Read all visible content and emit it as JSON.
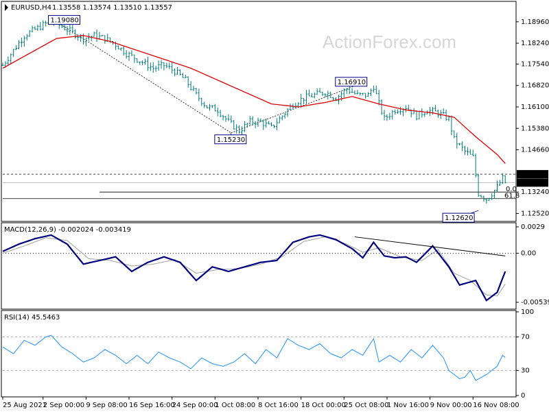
{
  "header": {
    "symbol": "EURUSD,H4",
    "ohlc": "1.13558 1.13574 1.13510 1.13557"
  },
  "watermark": "ActionForex.com",
  "colors": {
    "candle": "#007b7b",
    "ma": "#e00000",
    "macd": "#000080",
    "signal": "#a0a0a0",
    "rsi": "#1e90ff",
    "grid": "#000000",
    "label_border": "#000080"
  },
  "chart_data": [
    {
      "type": "candlestick",
      "name": "price",
      "ylim": [
        1.123,
        1.196
      ],
      "y_ticks": [
        "1.18960",
        "1.18240",
        "1.17540",
        "1.16820",
        "1.16100",
        "1.15380",
        "1.14660",
        "1.13240",
        "1.12520"
      ],
      "y_tick_values": [
        1.1896,
        1.1824,
        1.1754,
        1.1682,
        1.161,
        1.1538,
        1.1466,
        1.1324,
        1.1252
      ],
      "current_price_label": "1.13557",
      "current_price": 1.13557,
      "hline_label": "1.13840",
      "hline_value": 1.1384,
      "fib_labels": [
        "0.0",
        "61.8"
      ],
      "fib_values": [
        1.1324,
        1.1302
      ],
      "annotations": [
        {
          "text": "1.19080",
          "x": 18,
          "y": 1.1908
        },
        {
          "text": "1.15230",
          "x": 85,
          "y": 1.1523
        },
        {
          "text": "1.16910",
          "x": 134,
          "y": 1.1691
        },
        {
          "text": "1.12620",
          "x": 177,
          "y": 1.1262
        }
      ],
      "x_labels": [
        "25 Aug 2021",
        "2 Sep 00:00",
        "9 Sep 08:00",
        "16 Sep 16:00",
        "24 Sep 00:00",
        "1 Oct 08:00",
        "8 Oct 16:00",
        "18 Oct 00:00",
        "25 Oct 08:00",
        "1 Nov 16:00",
        "9 Nov 00:00",
        "16 Nov 08:00"
      ],
      "x_label_bars": [
        0,
        15,
        31,
        47,
        63,
        79,
        95,
        111,
        127,
        143,
        159,
        175
      ],
      "price_points": [
        [
          0,
          1.175
        ],
        [
          4,
          1.18
        ],
        [
          8,
          1.185
        ],
        [
          12,
          1.187
        ],
        [
          18,
          1.19
        ],
        [
          22,
          1.188
        ],
        [
          26,
          1.186
        ],
        [
          30,
          1.184
        ],
        [
          34,
          1.185
        ],
        [
          38,
          1.184
        ],
        [
          42,
          1.182
        ],
        [
          46,
          1.179
        ],
        [
          52,
          1.176
        ],
        [
          56,
          1.174
        ],
        [
          60,
          1.175
        ],
        [
          64,
          1.173
        ],
        [
          68,
          1.17
        ],
        [
          72,
          1.165
        ],
        [
          76,
          1.161
        ],
        [
          80,
          1.16
        ],
        [
          84,
          1.156
        ],
        [
          88,
          1.153
        ],
        [
          92,
          1.156
        ],
        [
          96,
          1.156
        ],
        [
          100,
          1.154
        ],
        [
          104,
          1.158
        ],
        [
          108,
          1.162
        ],
        [
          112,
          1.164
        ],
        [
          116,
          1.165
        ],
        [
          120,
          1.166
        ],
        [
          124,
          1.164
        ],
        [
          128,
          1.167
        ],
        [
          132,
          1.165
        ],
        [
          136,
          1.165
        ],
        [
          138,
          1.168
        ],
        [
          140,
          1.162
        ],
        [
          142,
          1.157
        ],
        [
          146,
          1.16
        ],
        [
          150,
          1.161
        ],
        [
          154,
          1.158
        ],
        [
          158,
          1.16
        ],
        [
          162,
          1.159
        ],
        [
          166,
          1.157
        ],
        [
          168,
          1.15
        ],
        [
          172,
          1.146
        ],
        [
          175,
          1.144
        ],
        [
          177,
          1.132
        ],
        [
          180,
          1.13
        ],
        [
          184,
          1.134
        ],
        [
          186,
          1.137
        ],
        [
          187,
          1.13557
        ]
      ],
      "ma_points": [
        [
          0,
          1.174
        ],
        [
          10,
          1.179
        ],
        [
          20,
          1.184
        ],
        [
          30,
          1.185
        ],
        [
          40,
          1.183
        ],
        [
          50,
          1.18
        ],
        [
          60,
          1.177
        ],
        [
          70,
          1.174
        ],
        [
          80,
          1.17
        ],
        [
          90,
          1.166
        ],
        [
          100,
          1.162
        ],
        [
          110,
          1.161
        ],
        [
          120,
          1.1625
        ],
        [
          130,
          1.1645
        ],
        [
          140,
          1.162
        ],
        [
          150,
          1.16
        ],
        [
          160,
          1.159
        ],
        [
          168,
          1.1575
        ],
        [
          176,
          1.151
        ],
        [
          184,
          1.145
        ],
        [
          187,
          1.142
        ]
      ]
    },
    {
      "type": "line",
      "name": "MACD(12,26,9) -0.002024 -0.003419",
      "ylim": [
        -0.006,
        0.0032
      ],
      "y_ticks": [
        "0.0029",
        "0.00",
        "-0.005396"
      ],
      "y_tick_values": [
        0.0029,
        0.0,
        -0.005396
      ],
      "macd_points": [
        [
          0,
          0.0002
        ],
        [
          6,
          0.001
        ],
        [
          12,
          0.0016
        ],
        [
          18,
          0.002
        ],
        [
          24,
          0.001
        ],
        [
          30,
          -0.0012
        ],
        [
          36,
          -0.0008
        ],
        [
          42,
          -0.0004
        ],
        [
          48,
          -0.002
        ],
        [
          54,
          -0.001
        ],
        [
          60,
          -0.0004
        ],
        [
          66,
          -0.001
        ],
        [
          72,
          -0.003
        ],
        [
          78,
          -0.0015
        ],
        [
          84,
          -0.002
        ],
        [
          90,
          -0.0015
        ],
        [
          96,
          -0.001
        ],
        [
          102,
          -0.0008
        ],
        [
          108,
          0.0012
        ],
        [
          114,
          0.0018
        ],
        [
          118,
          0.002
        ],
        [
          124,
          0.0015
        ],
        [
          130,
          0.0005
        ],
        [
          134,
          -0.0005
        ],
        [
          138,
          0.0012
        ],
        [
          142,
          -0.0003
        ],
        [
          146,
          -0.0005
        ],
        [
          150,
          -0.0004
        ],
        [
          154,
          -0.001
        ],
        [
          160,
          0.0008
        ],
        [
          166,
          -0.0015
        ],
        [
          170,
          -0.0035
        ],
        [
          176,
          -0.003
        ],
        [
          180,
          -0.0052
        ],
        [
          184,
          -0.0043
        ],
        [
          187,
          -0.002
        ]
      ],
      "signal_points": [
        [
          0,
          0.0
        ],
        [
          8,
          0.0008
        ],
        [
          16,
          0.0017
        ],
        [
          24,
          0.0014
        ],
        [
          32,
          -0.0006
        ],
        [
          40,
          -0.0008
        ],
        [
          48,
          -0.0014
        ],
        [
          56,
          -0.0012
        ],
        [
          64,
          -0.0007
        ],
        [
          72,
          -0.0022
        ],
        [
          80,
          -0.0018
        ],
        [
          88,
          -0.0017
        ],
        [
          96,
          -0.0012
        ],
        [
          104,
          -0.0004
        ],
        [
          112,
          0.0013
        ],
        [
          120,
          0.0018
        ],
        [
          128,
          0.001
        ],
        [
          134,
          0.0001
        ],
        [
          140,
          0.0006
        ],
        [
          148,
          -0.0004
        ],
        [
          156,
          -0.0008
        ],
        [
          162,
          0.0004
        ],
        [
          168,
          -0.0022
        ],
        [
          174,
          -0.003
        ],
        [
          180,
          -0.0046
        ],
        [
          184,
          -0.0047
        ],
        [
          187,
          -0.0034
        ]
      ],
      "trendline": [
        [
          131,
          0.0018
        ],
        [
          187,
          -0.0003
        ]
      ]
    },
    {
      "type": "line",
      "name": "RSI(14) 45.5463",
      "ylim": [
        0,
        100
      ],
      "y_ticks": [
        "100",
        "70",
        "30",
        "0"
      ],
      "y_tick_values": [
        100,
        70,
        30,
        0
      ],
      "levels": [
        70,
        30
      ],
      "rsi_points": [
        [
          0,
          58
        ],
        [
          4,
          50
        ],
        [
          8,
          66
        ],
        [
          12,
          60
        ],
        [
          16,
          70
        ],
        [
          18,
          72
        ],
        [
          22,
          58
        ],
        [
          26,
          50
        ],
        [
          30,
          40
        ],
        [
          34,
          45
        ],
        [
          38,
          55
        ],
        [
          42,
          48
        ],
        [
          46,
          38
        ],
        [
          50,
          48
        ],
        [
          54,
          38
        ],
        [
          58,
          52
        ],
        [
          62,
          45
        ],
        [
          66,
          40
        ],
        [
          70,
          32
        ],
        [
          74,
          45
        ],
        [
          78,
          38
        ],
        [
          82,
          35
        ],
        [
          86,
          40
        ],
        [
          90,
          50
        ],
        [
          94,
          38
        ],
        [
          98,
          55
        ],
        [
          102,
          45
        ],
        [
          106,
          68
        ],
        [
          110,
          60
        ],
        [
          114,
          55
        ],
        [
          118,
          62
        ],
        [
          122,
          50
        ],
        [
          126,
          45
        ],
        [
          130,
          55
        ],
        [
          134,
          48
        ],
        [
          138,
          68
        ],
        [
          140,
          40
        ],
        [
          144,
          48
        ],
        [
          148,
          40
        ],
        [
          152,
          55
        ],
        [
          156,
          45
        ],
        [
          160,
          60
        ],
        [
          164,
          45
        ],
        [
          166,
          30
        ],
        [
          170,
          20
        ],
        [
          172,
          22
        ],
        [
          174,
          30
        ],
        [
          176,
          18
        ],
        [
          180,
          25
        ],
        [
          184,
          35
        ],
        [
          186,
          48
        ],
        [
          187,
          45.5
        ]
      ]
    }
  ]
}
